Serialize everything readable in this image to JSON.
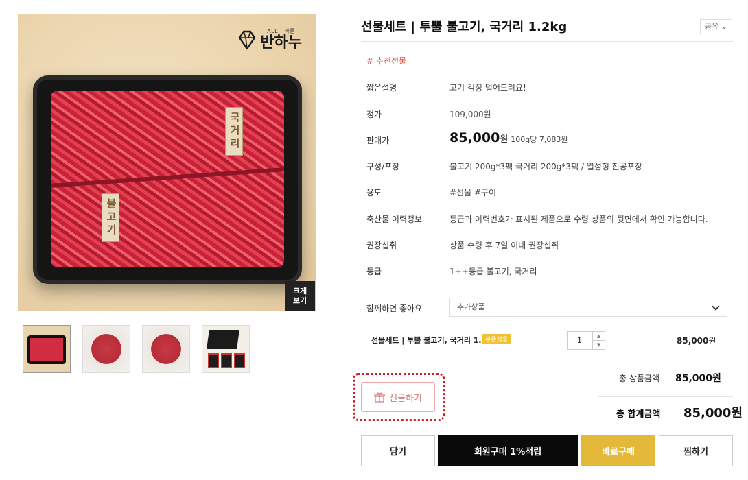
{
  "product": {
    "title": "선물세트 | 투뿔 불고기, 국거리 1.2kg",
    "share_label": "공유 ⌄",
    "hashtag": "# 추천선물",
    "zoom_label_1": "크게",
    "zoom_label_2": "보기",
    "brand_small": "ALL : 바른",
    "brand_name": "반하누",
    "image_tag_1": "국거리",
    "image_tag_2": "불고기"
  },
  "info_rows": [
    {
      "label": "짧은설명",
      "value": "고기 걱정 덜어드려요!"
    },
    {
      "label": "정가",
      "value": "109,000원"
    },
    {
      "label": "판매가",
      "price": "85,000",
      "unit": "원",
      "per": "100g당 7,083원"
    },
    {
      "label": "구성/포장",
      "value": "불고기 200g*3팩 국거리 200g*3팩 / 열성형 진공포장"
    },
    {
      "label": "용도",
      "value": "#선물 #구이"
    },
    {
      "label": "축산물 이력정보",
      "value": "등급과 이력번호가 표시된 제품으로 수령 상품의 뒷면에서 확인 가능합니다."
    },
    {
      "label": "권장섭취",
      "value": "상품 수령 후 7일 이내 권장섭취"
    },
    {
      "label": "등급",
      "value": "1++등급 불고기, 국거리"
    }
  ],
  "addon": {
    "label": "함께하면 좋아요",
    "select_value": "추가상품"
  },
  "option": {
    "name": "선물세트 | 투뿔 불고기, 국거리 1.2kg",
    "coupon": "쿠폰적용",
    "quantity": "1",
    "price": "85,000",
    "unit": "원"
  },
  "gift": {
    "label": "선물하기"
  },
  "summary": {
    "subtotal_label": "총 상품금액",
    "subtotal_value": "85,000원",
    "total_label": "총 합계금액",
    "total_value": "85,000원"
  },
  "actions": {
    "cart": "담기",
    "member_buy": "회원구매 1%적립",
    "buy_now": "바로구매",
    "wish": "찜하기"
  },
  "colors": {
    "accent_red": "#e04a4a",
    "buy_yellow": "#e4b93a",
    "member_black": "#0a0a0a",
    "coupon_yellow": "#f2c12e"
  }
}
